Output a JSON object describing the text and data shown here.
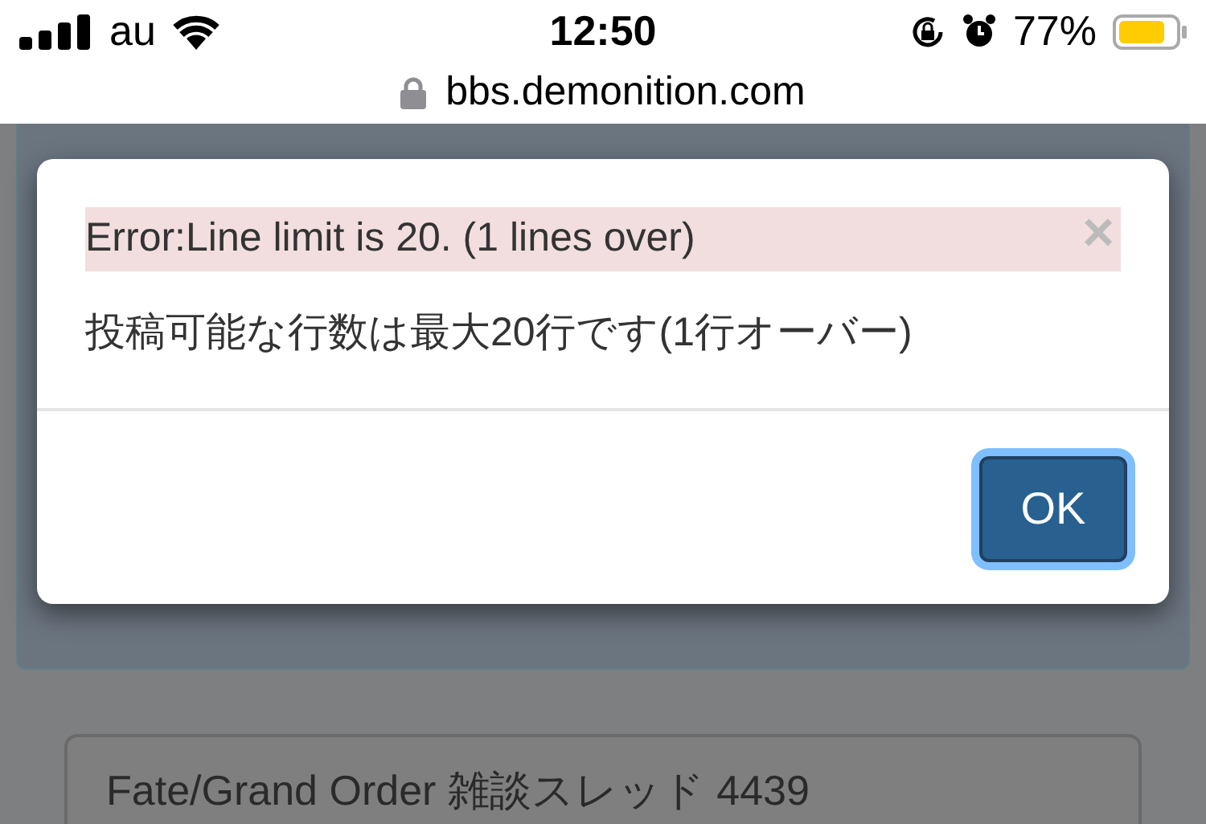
{
  "status_bar": {
    "carrier": "au",
    "time": "12:50",
    "battery": "77%"
  },
  "address_bar": {
    "url": "bbs.demonition.com"
  },
  "dialog": {
    "error": "Error:Line limit is 20. (1 lines over)",
    "message": "投稿可能な行数は最大20行です(1行オーバー)",
    "close": "×",
    "buttons": [
      {
        "label": "OK",
        "focused": true
      }
    ]
  },
  "page": {
    "thread_title": "Fate/Grand Order 雑談スレッド 4439"
  }
}
